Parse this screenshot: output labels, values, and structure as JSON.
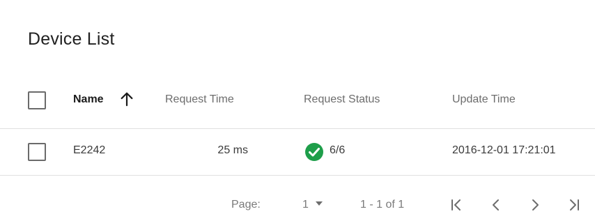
{
  "card": {
    "title": "Device List"
  },
  "table": {
    "columns": {
      "name": "Name",
      "request_time": "Request Time",
      "request_status": "Request Status",
      "update_time": "Update Time"
    },
    "sort": {
      "column": "name",
      "direction": "ascending",
      "icon": "arrow-up-icon"
    },
    "rows": [
      {
        "name": "E2242",
        "request_time": "25 ms",
        "request_status": "6/6",
        "status_icon": "check-circle-icon",
        "update_time": "2016-12-01 17:21:01"
      }
    ]
  },
  "pagination": {
    "page_label": "Page:",
    "page_value": "1",
    "range": "1 - 1 of 1"
  },
  "colors": {
    "status_ok": "#1e9e4a",
    "divider": "#e0e0e0",
    "icon_gray": "#6d6d6d"
  }
}
